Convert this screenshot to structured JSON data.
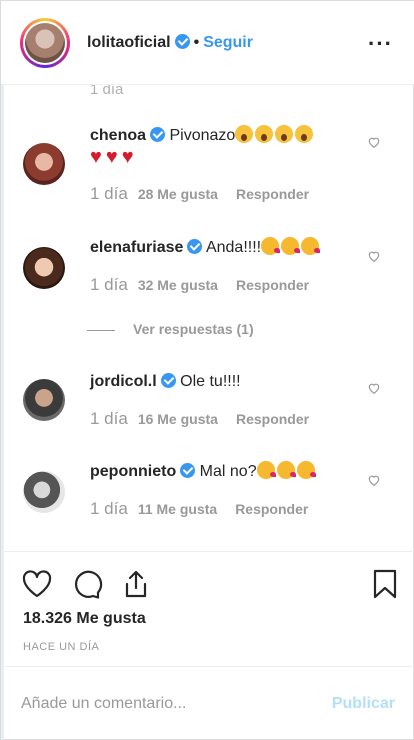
{
  "header": {
    "username": "lolitaoficial",
    "separator": "•",
    "follow_label": "Seguir",
    "more_label": "···"
  },
  "ghost_time": "1 día",
  "comments": [
    {
      "username": "chenoa",
      "text": "Pivonazo",
      "emoji": [
        "face-screaming",
        "face-screaming",
        "face-screaming",
        "face-screaming"
      ],
      "second_line_emoji": [
        "red-heart",
        "red-heart",
        "red-heart"
      ],
      "time": "1 día",
      "likes": "28 Me gusta",
      "reply": "Responder"
    },
    {
      "username": "elenafuriase",
      "text": "Anda!!!!",
      "emoji": [
        "face-kiss",
        "face-kiss",
        "face-kiss"
      ],
      "time": "1 día",
      "likes": "32 Me gusta",
      "reply": "Responder"
    },
    {
      "username": "jordicol.l",
      "text": "Ole tu!!!!",
      "emoji": [],
      "time": "1 día",
      "likes": "16 Me gusta",
      "reply": "Responder"
    },
    {
      "username": "peponnieto",
      "text": "Mal no?",
      "emoji": [
        "face-kiss",
        "face-kiss",
        "face-kiss"
      ],
      "time": "1 día",
      "likes": "11 Me gusta",
      "reply": "Responder"
    }
  ],
  "view_replies": "Ver respuestas (1)",
  "actions": {
    "icons": [
      "heart-icon",
      "comment-icon",
      "share-icon",
      "bookmark-icon"
    ],
    "likes_count": "18.326 Me gusta",
    "posted": "HACE UN DÍA"
  },
  "add_comment": {
    "placeholder": "Añade un comentario...",
    "publish_label": "Publicar"
  },
  "colors": {
    "accent": "#3897f0",
    "publish_disabled": "#b2dffc",
    "meta_gray": "#999999",
    "heart_red": "#d51b2c"
  }
}
